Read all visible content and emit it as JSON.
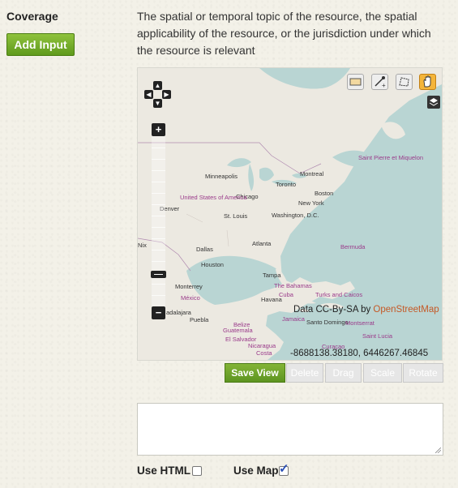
{
  "field": {
    "label": "Coverage",
    "add_button": "Add Input",
    "description": "The spatial or temporal topic of the resource, the spatial applicability of the resource, or the jurisdiction under which the resource is relevant"
  },
  "map": {
    "zoom_in": "+",
    "zoom_out": "−",
    "attribution_prefix": "Data CC-By-SA by ",
    "attribution_link": "OpenStreetMap",
    "coordinates": "-8688138.38180, 6446267.46845",
    "cities": [
      "Minneapolis",
      "Toronto",
      "Montreal",
      "Boston",
      "Chicago",
      "New York",
      "St. Louis",
      "Washington, D.C.",
      "Denver",
      "Dallas",
      "Atlanta",
      "Houston",
      "Tampa",
      "Monterrey",
      "Puebla",
      "Havana",
      "Santo Domingo",
      "Guatemala",
      "El Salvador",
      "Nicaragua",
      "Costa",
      "Jamaica",
      "Montserrat",
      "Curaçao",
      "Saint Lucia",
      "Nix",
      "adalajara"
    ],
    "regions": [
      "Saint Pierre et Miquelon",
      "United States of America",
      "Bermuda",
      "The Bahamas",
      "Cuba",
      "Turks and Caicos Islands",
      "México",
      "Belize"
    ],
    "tools": [
      "draw-box-tool",
      "draw-point-tool",
      "draw-polygon-tool",
      "pan-tool"
    ]
  },
  "map_buttons": {
    "save": "Save View",
    "delete": "Delete",
    "drag": "Drag",
    "scale": "Scale",
    "rotate": "Rotate"
  },
  "options": {
    "use_html": "Use HTML",
    "use_html_checked": false,
    "use_map": "Use Map",
    "use_map_checked": true,
    "check_mark": "✓"
  },
  "colors": {
    "accent": "#6aa226",
    "water": "#b9d5d3",
    "land": "#ece9e1",
    "osm_link": "#c55926"
  }
}
